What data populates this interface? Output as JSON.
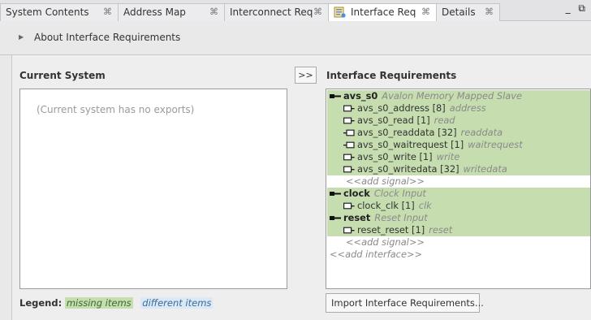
{
  "tabs": [
    {
      "label": "System Contents",
      "close": "⌘"
    },
    {
      "label": "Address Map",
      "close": "⌘"
    },
    {
      "label": "Interconnect Req",
      "close": "⌘"
    },
    {
      "label": "Interface Req",
      "close": "⌘",
      "icon": "interface-requirements-icon",
      "active": true
    },
    {
      "label": "Details",
      "close": "⌘"
    }
  ],
  "window_controls": "_ ⧉",
  "about": {
    "label": "About Interface Requirements",
    "icon": "chevron-right-icon"
  },
  "current_system": {
    "title": "Current System",
    "placeholder": "(Current system has no exports)"
  },
  "transfer_button": ">>",
  "interface_requirements": {
    "title": "Interface Requirements",
    "rows": [
      {
        "kind": "interface",
        "name": "avs_s0",
        "type": "Avalon Memory Mapped Slave",
        "icon": "interface-icon"
      },
      {
        "kind": "signal",
        "text": "avs_s0_address [8]",
        "role": "address",
        "icon": "output-port-icon"
      },
      {
        "kind": "signal",
        "text": "avs_s0_read [1]",
        "role": "read",
        "icon": "output-port-icon"
      },
      {
        "kind": "signal",
        "text": "avs_s0_readdata [32]",
        "role": "readdata",
        "icon": "input-port-icon"
      },
      {
        "kind": "signal",
        "text": "avs_s0_waitrequest [1]",
        "role": "waitrequest",
        "icon": "input-port-icon"
      },
      {
        "kind": "signal",
        "text": "avs_s0_write [1]",
        "role": "write",
        "icon": "output-port-icon"
      },
      {
        "kind": "signal",
        "text": "avs_s0_writedata [32]",
        "role": "writedata",
        "icon": "output-port-icon"
      },
      {
        "kind": "add-signal",
        "text": "<<add signal>>"
      },
      {
        "kind": "interface",
        "name": "clock",
        "type": "Clock Input",
        "icon": "interface-icon"
      },
      {
        "kind": "signal",
        "text": "clock_clk [1]",
        "role": "clk",
        "icon": "output-port-icon"
      },
      {
        "kind": "interface",
        "name": "reset",
        "type": "Reset Input",
        "icon": "interface-icon"
      },
      {
        "kind": "signal",
        "text": "reset_reset [1]",
        "role": "reset",
        "icon": "output-port-icon"
      },
      {
        "kind": "add-signal",
        "text": "<<add signal>>"
      },
      {
        "kind": "add-interface",
        "text": "<<add interface>>"
      }
    ]
  },
  "legend": {
    "label": "Legend:",
    "missing": "missing items",
    "different": "different items"
  },
  "import_button": "Import Interface Requirements...",
  "colors": {
    "missing_bg": "#c6ddb0",
    "different_bg": "#dbe9f6",
    "panel_bg": "#eeeeef"
  }
}
